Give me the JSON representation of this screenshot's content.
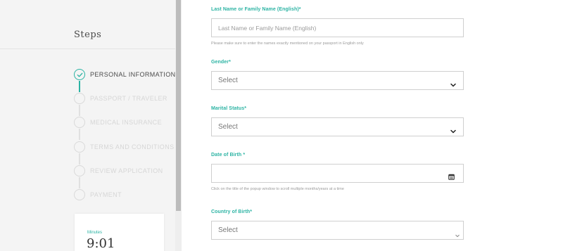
{
  "sidebar": {
    "title": "Steps",
    "steps": [
      {
        "label": "PERSONAL INFORMATION",
        "state": "done"
      },
      {
        "label": "PASSPORT / TRAVELER",
        "state": "pending"
      },
      {
        "label": "MEDICAL INSURANCE",
        "state": "pending"
      },
      {
        "label": "TERMS AND CONDITIONS",
        "state": "pending"
      },
      {
        "label": "REVIEW APPLICATION",
        "state": "pending"
      },
      {
        "label": "PAYMENT",
        "state": "pending"
      }
    ],
    "timer": {
      "label": "Minutes",
      "value": "9:01"
    }
  },
  "form": {
    "last_name": {
      "label": "Last Name or Family Name (English)*",
      "placeholder": "Last Name or Family Name (English)",
      "hint": "Please make sure to enter the names exactly mentioned on your passport in English only"
    },
    "gender": {
      "label": "Gender*",
      "value": "Select"
    },
    "marital_status": {
      "label": "Marital Status*",
      "value": "Select"
    },
    "dob": {
      "label": "Date of Birth *",
      "hint": "Click on the title of the popup window to scroll multiple months/years at a time"
    },
    "country_of_birth": {
      "label": "Country of Birth*",
      "value": "Select"
    }
  },
  "colors": {
    "accent": "#2bb3a3",
    "sidebar_bg": "#f4f4f4",
    "border": "#cfcfcf"
  }
}
